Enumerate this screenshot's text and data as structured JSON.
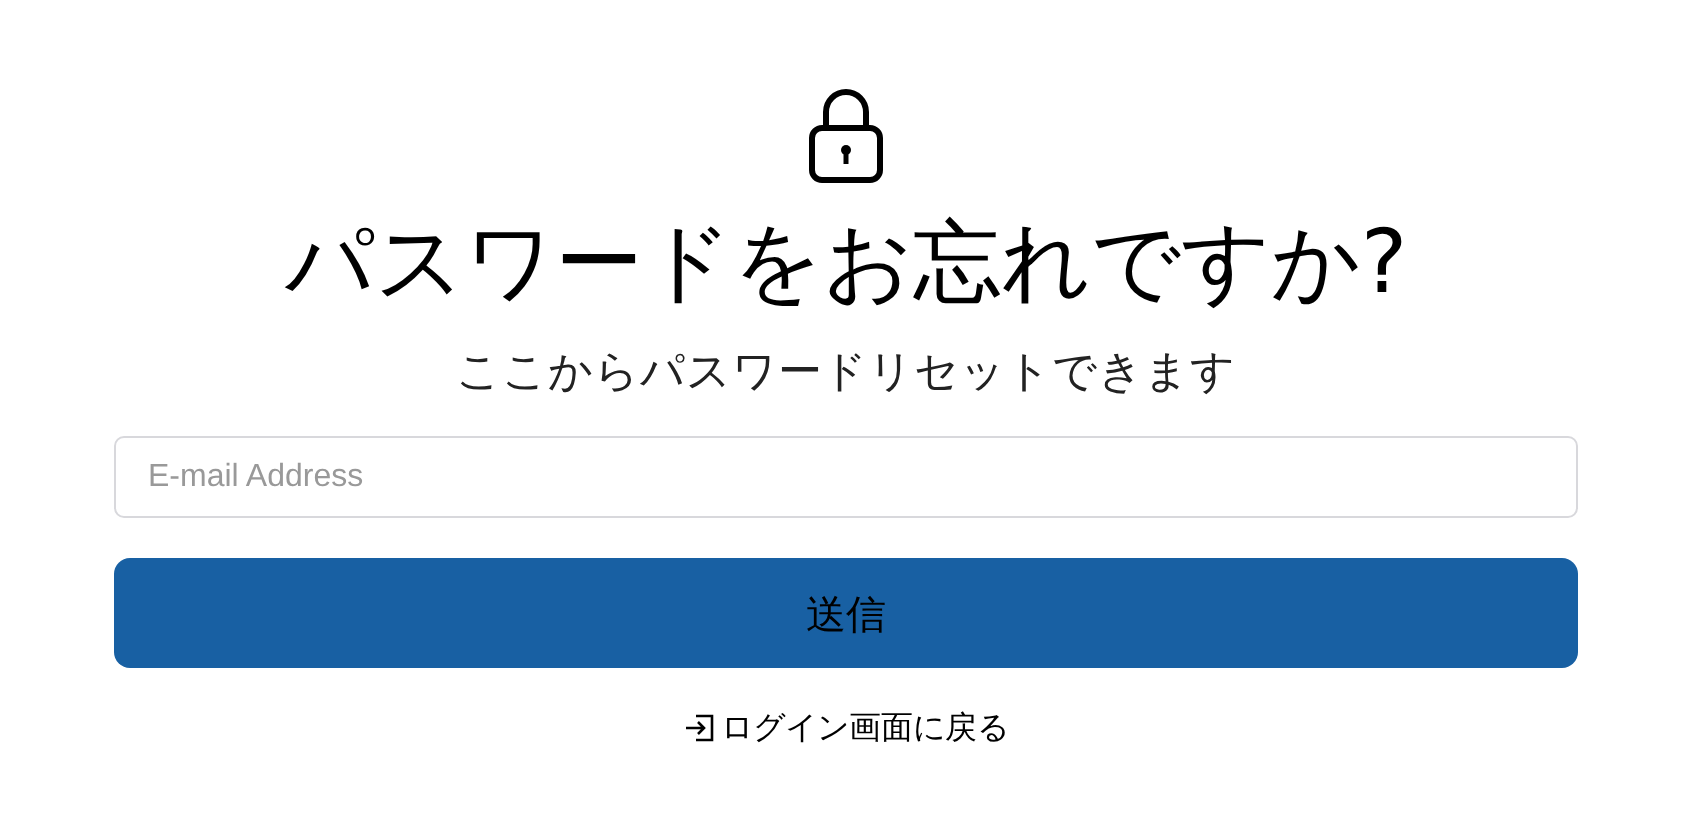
{
  "title": "パスワードをお忘れですか?",
  "subtitle": "ここからパスワードリセットできます",
  "email_field": {
    "placeholder": "E-mail Address"
  },
  "submit_button": {
    "label": "送信"
  },
  "back_link": {
    "label": "ログイン画面に戻る"
  }
}
